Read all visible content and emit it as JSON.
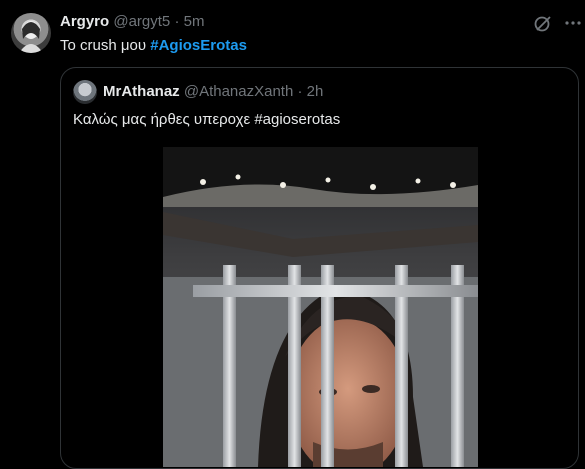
{
  "tweet": {
    "author_name": "Argyro",
    "handle": "@argyt5",
    "separator": "·",
    "time": "5m",
    "text_prefix": "Το crush μου ",
    "hashtag": "#AgiosErotas"
  },
  "quoted": {
    "author_name": "MrAthanaz",
    "handle": "@AthanazXanth",
    "separator": "·",
    "time": "2h",
    "text": "Καλώς μας ήρθες υπεροχε  #agioserotas"
  },
  "icons": {
    "grok": "grok-icon",
    "more": "more-dots-icon"
  },
  "colors": {
    "background": "#000000",
    "text": "#e7e9ea",
    "muted": "#71767b",
    "accent": "#1d9bf0",
    "border": "#2f3336"
  }
}
